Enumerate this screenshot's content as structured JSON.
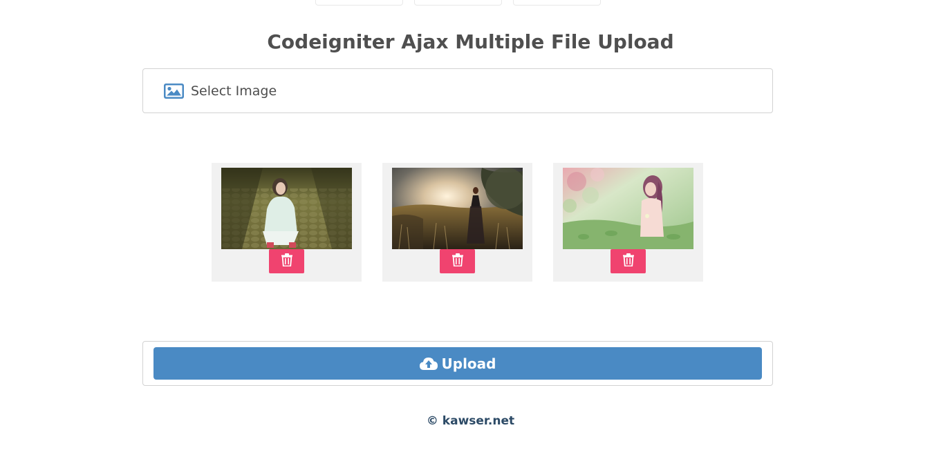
{
  "page": {
    "title": "Codeigniter Ajax Multiple File Upload"
  },
  "select_image": {
    "label": "Select Image",
    "icon": "image-icon"
  },
  "images": [
    {
      "name": "girl-on-cobblestones",
      "delete_icon": "trash-icon"
    },
    {
      "name": "woman-in-field-sunset",
      "delete_icon": "trash-icon"
    },
    {
      "name": "girl-in-flowers",
      "delete_icon": "trash-icon"
    }
  ],
  "upload": {
    "label": "Upload",
    "icon": "cloud-upload-icon"
  },
  "footer": {
    "text": "© kawser.net"
  },
  "colors": {
    "primary": "#4a8ac4",
    "danger": "#f0436f",
    "thumb_bg": "#f1f1f1",
    "footer_text": "#2c4a66"
  }
}
